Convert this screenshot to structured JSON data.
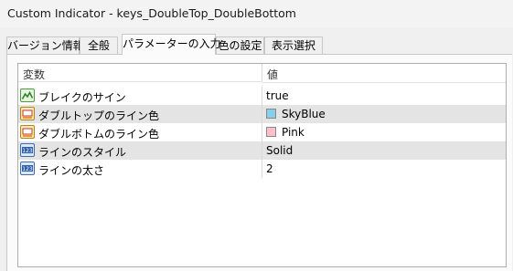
{
  "window": {
    "title": "Custom Indicator - keys_DoubleTop_DoubleBottom"
  },
  "tabs": [
    {
      "label": "バージョン情報",
      "active": false
    },
    {
      "label": "全般",
      "active": false
    },
    {
      "label": "パラメーターの入力",
      "active": true
    },
    {
      "label": "色の設定",
      "active": false
    },
    {
      "label": "表示選択",
      "active": false
    }
  ],
  "grid": {
    "header": {
      "name": "変数",
      "value": "値"
    },
    "rows": [
      {
        "icon": "bool-icon",
        "name": "ブレイクのサイン",
        "value": "true",
        "color": null
      },
      {
        "icon": "color-icon",
        "name": "ダブルトップのライン色",
        "value": "SkyBlue",
        "color": "#87ceeb"
      },
      {
        "icon": "color-icon",
        "name": "ダブルボトムのライン色",
        "value": "Pink",
        "color": "#ffc0cb"
      },
      {
        "icon": "int-icon",
        "name": "ラインのスタイル",
        "value": "Solid",
        "color": null
      },
      {
        "icon": "int-icon",
        "name": "ラインの太さ",
        "value": "2",
        "color": null
      }
    ]
  }
}
